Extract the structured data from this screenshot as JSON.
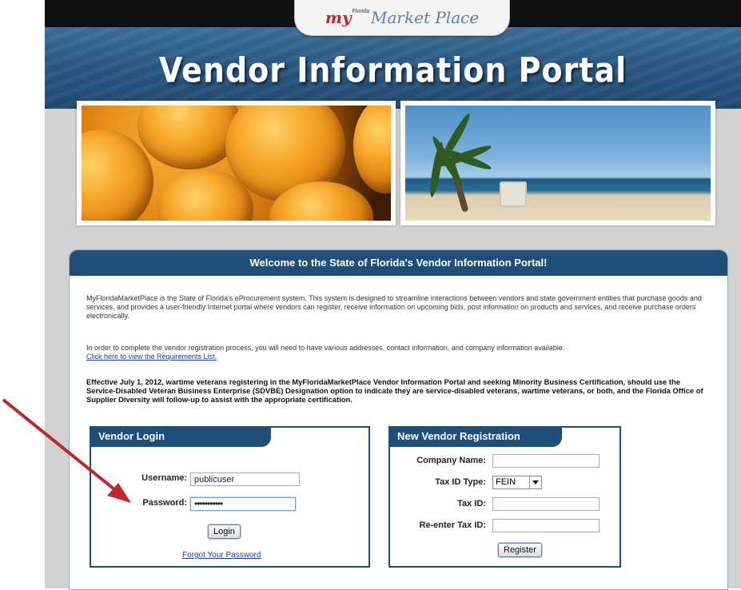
{
  "logo": {
    "my": "my",
    "small": "Florida",
    "marketplace": "Market Place"
  },
  "banner": {
    "title": "Vendor Information Portal"
  },
  "welcome": {
    "header": "Welcome to the State of Florida's Vendor Information Portal!",
    "intro": "MyFloridaMarketPlace is the State of Florida's eProcurement system. This system is designed to streamline interactions between vendors and state government entities that purchase goods and services, and provides a user-friendly Internet portal where vendors can register, receive information on upcoming bids, post information on products and services, and receive purchase orders electronically.",
    "registration_note": "In order to complete the vendor registration process, you will need to have various addresses, contact information, and company information available.",
    "requirements_link": "Click here to view the Requirements List.",
    "veterans_note": "Effective July 1, 2012, wartime veterans registering in the MyFloridaMarketPlace Vendor Information Portal and seeking Minority Business Certification, should use the Service-Disabled Veteran Business Enterprise (SDVBE) Designation option to indicate they are service-disabled veterans, wartime veterans, or both, and the Florida Office of Supplier Diversity will follow-up to assist with the appropriate certification."
  },
  "login": {
    "header": "Vendor Login",
    "username_label": "Username:",
    "username_value": "publicuser",
    "password_label": "Password:",
    "password_value": "•••••••••••",
    "login_button": "Login",
    "forgot_link": "Forgot Your Password"
  },
  "registration": {
    "header": "New Vendor Registration",
    "company_label": "Company Name:",
    "company_value": "",
    "taxid_type_label": "Tax ID Type:",
    "taxid_type_value": "FEIN",
    "taxid_label": "Tax ID:",
    "taxid_value": "",
    "reenter_label": "Re-enter Tax ID:",
    "reenter_value": "",
    "register_button": "Register"
  },
  "colors": {
    "header_blue": "#1f4f79",
    "annotation_arrow": "#c0262d"
  }
}
